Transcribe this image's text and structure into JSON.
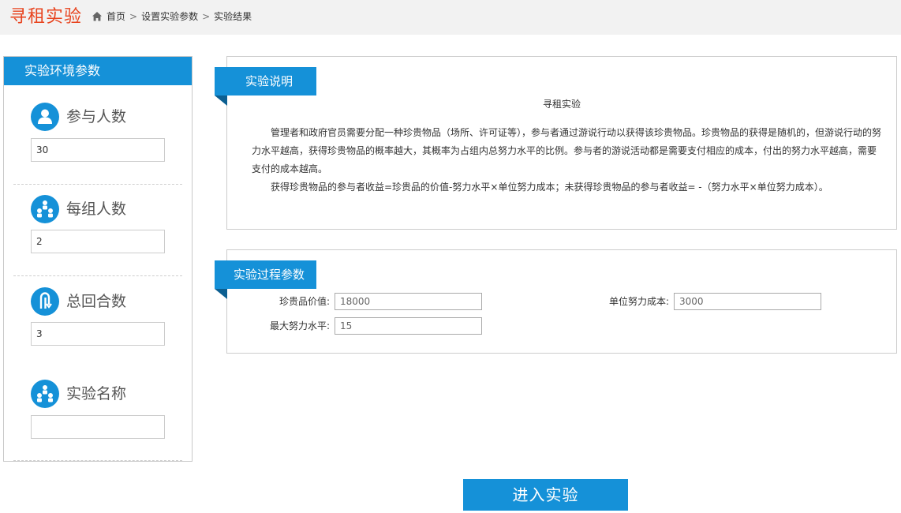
{
  "header": {
    "app_title": "寻租实验",
    "breadcrumb": [
      "首页",
      "设置实验参数",
      "实验结果"
    ]
  },
  "sidebar": {
    "title": "实验环境参数",
    "params": [
      {
        "label": "参与人数",
        "value": "30",
        "icon": "person-icon"
      },
      {
        "label": "每组人数",
        "value": "2",
        "icon": "group-icon"
      },
      {
        "label": "总回合数",
        "value": "3",
        "icon": "rounds-icon"
      },
      {
        "label": "实验名称",
        "value": "",
        "icon": "group-icon"
      }
    ]
  },
  "description": {
    "ribbon": "实验说明",
    "title": "寻租实验",
    "paragraph1": "管理者和政府官员需要分配一种珍贵物品（场所、许可证等），参与者通过游说行动以获得该珍贵物品。珍贵物品的获得是随机的，但游说行动的努力水平越高，获得珍贵物品的概率越大，其概率为占组内总努力水平的比例。参与者的游说活动都是需要支付相应的成本，付出的努力水平越高，需要支付的成本越高。",
    "paragraph2": "获得珍贵物品的参与者收益=珍贵品的价值-努力水平×单位努力成本；未获得珍贵物品的参与者收益= -（努力水平×单位努力成本）。"
  },
  "process": {
    "ribbon": "实验过程参数",
    "fields": {
      "value_label": "珍贵品价值:",
      "value": "18000",
      "cost_label": "单位努力成本:",
      "cost": "3000",
      "max_effort_label": "最大努力水平:",
      "max_effort": "15"
    }
  },
  "actions": {
    "enter_label": "进入实验"
  },
  "colors": {
    "accent": "#1591d8",
    "title_red": "#e8431e"
  }
}
